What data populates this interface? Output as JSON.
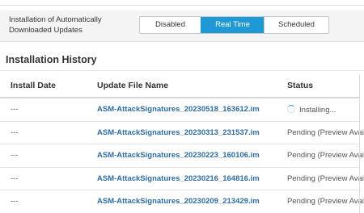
{
  "settings": {
    "label_line1": "Installation of Automatically",
    "label_line2": "Downloaded Updates",
    "options": [
      "Disabled",
      "Real Time",
      "Scheduled"
    ],
    "selected": "Real Time",
    "accent_color": "#1f98d6"
  },
  "history": {
    "title": "Installation History",
    "columns": [
      "Install Date",
      "Update File Name",
      "Status"
    ],
    "rows": [
      {
        "date": "---",
        "file": "ASM-AttackSignatures_20230518_163612.im",
        "status": "Installing...",
        "status_icon": "spinner-icon"
      },
      {
        "date": "---",
        "file": "ASM-AttackSignatures_20230313_231537.im",
        "status": "Pending (Preview Avai"
      },
      {
        "date": "---",
        "file": "ASM-AttackSignatures_20230223_160106.im",
        "status": "Pending (Preview Avai"
      },
      {
        "date": "---",
        "file": "ASM-AttackSignatures_20230216_164816.im",
        "status": "Pending (Preview Avai"
      },
      {
        "date": "---",
        "file": "ASM-AttackSignatures_20230209_213429.im",
        "status": "Pending (Preview Avai"
      }
    ]
  }
}
